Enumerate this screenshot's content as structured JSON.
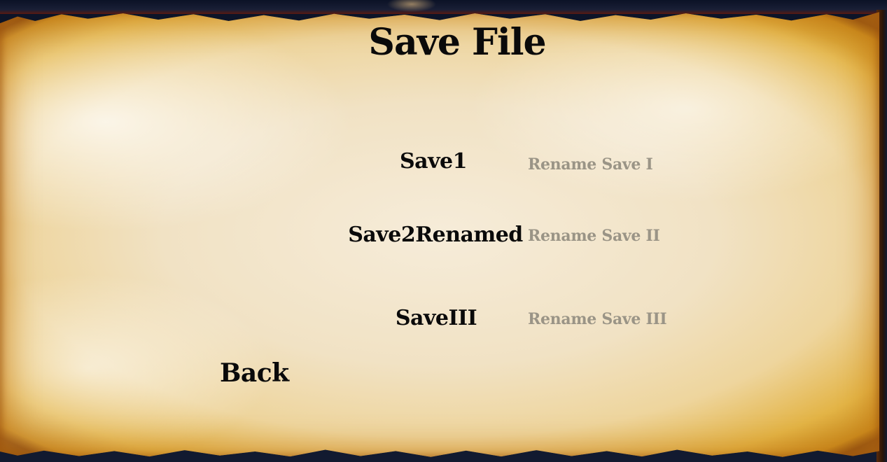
{
  "screen": {
    "title": "Save File",
    "saves": [
      {
        "name": "Save1",
        "rename_label": "Rename Save I"
      },
      {
        "name": "Save2Renamed",
        "rename_label": "Rename Save II"
      },
      {
        "name": "SaveIII",
        "rename_label": "Rename Save III"
      }
    ],
    "back_label": "Back"
  },
  "colors": {
    "text_primary": "#0a0a0a",
    "text_disabled": "#9a9486",
    "parchment": "#f1e2c4",
    "burn": "#c98a1e",
    "background": "#0b1120"
  }
}
